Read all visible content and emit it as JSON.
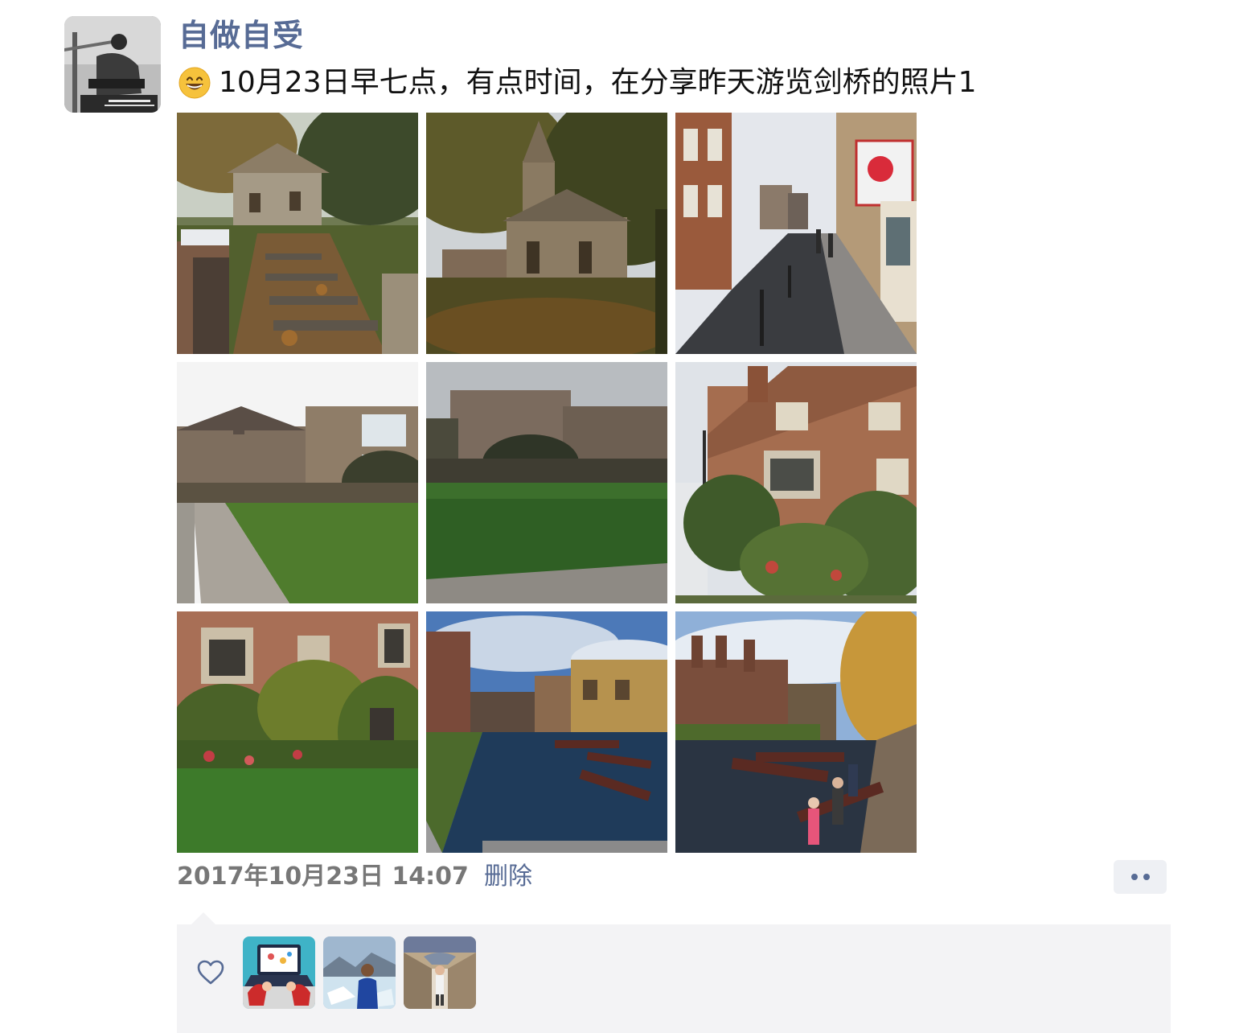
{
  "post": {
    "user_name": "自做自受",
    "emoji": "grinning-face",
    "text": "10月23日早七点，有点时间，在分享昨天游览剑桥的照片1",
    "photos": [
      {
        "id": "photo-1",
        "subject": "church-steps-icon"
      },
      {
        "id": "photo-2",
        "subject": "church-tower-icon"
      },
      {
        "id": "photo-3",
        "subject": "street-icon"
      },
      {
        "id": "photo-4",
        "subject": "courtyard-lawn-icon"
      },
      {
        "id": "photo-5",
        "subject": "courtyard-lawn-icon"
      },
      {
        "id": "photo-6",
        "subject": "brick-building-icon"
      },
      {
        "id": "photo-7",
        "subject": "brick-building-icon"
      },
      {
        "id": "photo-8",
        "subject": "river-punts-icon"
      },
      {
        "id": "photo-9",
        "subject": "river-punts-icon"
      }
    ],
    "timestamp": "2017年10月23日 14:07",
    "delete_label": "删除",
    "more_icon": "more-dots-icon"
  },
  "likes": {
    "icon": "heart-outline-icon",
    "users": [
      {
        "avatar": "laptop-avatar"
      },
      {
        "avatar": "glacier-avatar"
      },
      {
        "avatar": "street-avatar"
      }
    ]
  },
  "colors": {
    "link": "#576b95",
    "text": "#111111",
    "meta": "#777777",
    "panel": "#f3f3f5"
  }
}
